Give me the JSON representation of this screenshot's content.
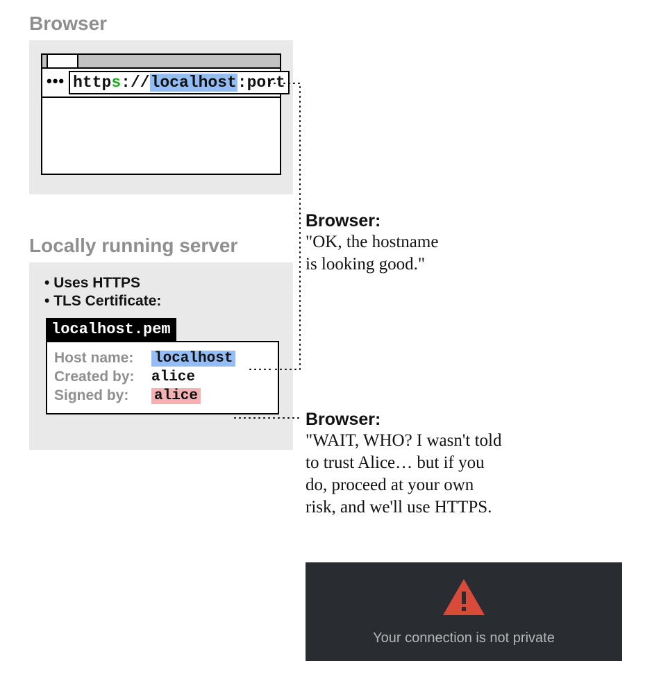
{
  "browser": {
    "section_label": "Browser",
    "url": {
      "scheme_pre": "http",
      "scheme_s": "s",
      "sep": "://",
      "host": "localhost",
      "port_sep_port": ":port"
    },
    "dots": "•••"
  },
  "server": {
    "section_label": "Locally running server",
    "bullet1": "Uses HTTPS",
    "bullet2": "TLS Certificate:",
    "pem_filename": "localhost.pem",
    "cert": {
      "hostname_label": "Host name:",
      "hostname_value": "localhost",
      "createdby_label": "Created by:",
      "createdby_value": "alice",
      "signedby_label": "Signed by:",
      "signedby_value": "alice"
    }
  },
  "speech": {
    "title": "Browser:",
    "line1a": "\"OK, the hostname",
    "line1b": "is looking good.\"",
    "line2a": "\"WAIT, WHO? I wasn't told",
    "line2b": "to trust Alice… but if you",
    "line2c": "do, proceed at your own",
    "line2d": "risk, and we'll use HTTPS."
  },
  "warning": {
    "text": "Your connection is not private"
  }
}
